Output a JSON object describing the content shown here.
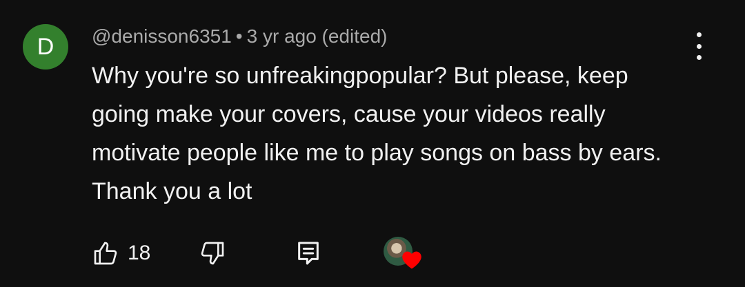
{
  "comment": {
    "avatar_letter": "D",
    "avatar_color": "#33802d",
    "username": "@denisson6351",
    "separator": "•",
    "time": "3 yr ago (edited)",
    "text": "Why you're so unfreakingpopular? But please, keep going make your covers, cause your videos really motivate people like me to play songs on bass by ears. Thank you a lot",
    "like_count": "18",
    "creator_heart_color": "#ff0000"
  },
  "icons": {
    "more": "more-vertical-icon",
    "like": "thumbs-up-icon",
    "dislike": "thumbs-down-icon",
    "reply": "reply-comment-icon",
    "heart": "heart-icon"
  }
}
